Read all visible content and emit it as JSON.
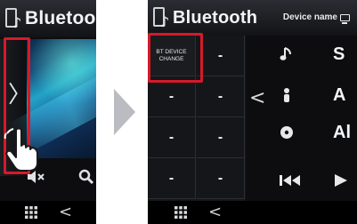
{
  "left_screen": {
    "title": "Bluetoo",
    "expand_icon": "chevron-right-icon",
    "mute_icon": "speaker-mute-icon",
    "search_icon": "search-icon",
    "grid_icon": "grid-menu-icon",
    "back_icon": "chevron-left-icon",
    "back_label": "<"
  },
  "right_screen": {
    "title": "Bluetooth",
    "device_name_label": "Device name",
    "function_buttons": [
      {
        "label": "BT DEVICE\nCHANGE",
        "highlighted": true
      },
      {
        "label": "-"
      },
      {
        "label": "-"
      },
      {
        "label": "-"
      },
      {
        "label": "-"
      },
      {
        "label": "-"
      },
      {
        "label": "-"
      },
      {
        "label": "-"
      }
    ],
    "collapse_label": "<",
    "song_info": [
      {
        "icon": "music-note-icon",
        "text": "S"
      },
      {
        "icon": "artist-icon",
        "text": "A"
      },
      {
        "icon": "album-disc-icon",
        "text": "Al"
      }
    ],
    "controls": {
      "prev_icon": "skip-previous-icon",
      "next_icon": "play-icon"
    },
    "grid_icon": "grid-menu-icon",
    "back_label": "<"
  },
  "annotation": {
    "highlight_color": "#d51a2a",
    "pointer_icon": "tap-hand-icon",
    "transition_icon": "arrow-right-icon"
  }
}
